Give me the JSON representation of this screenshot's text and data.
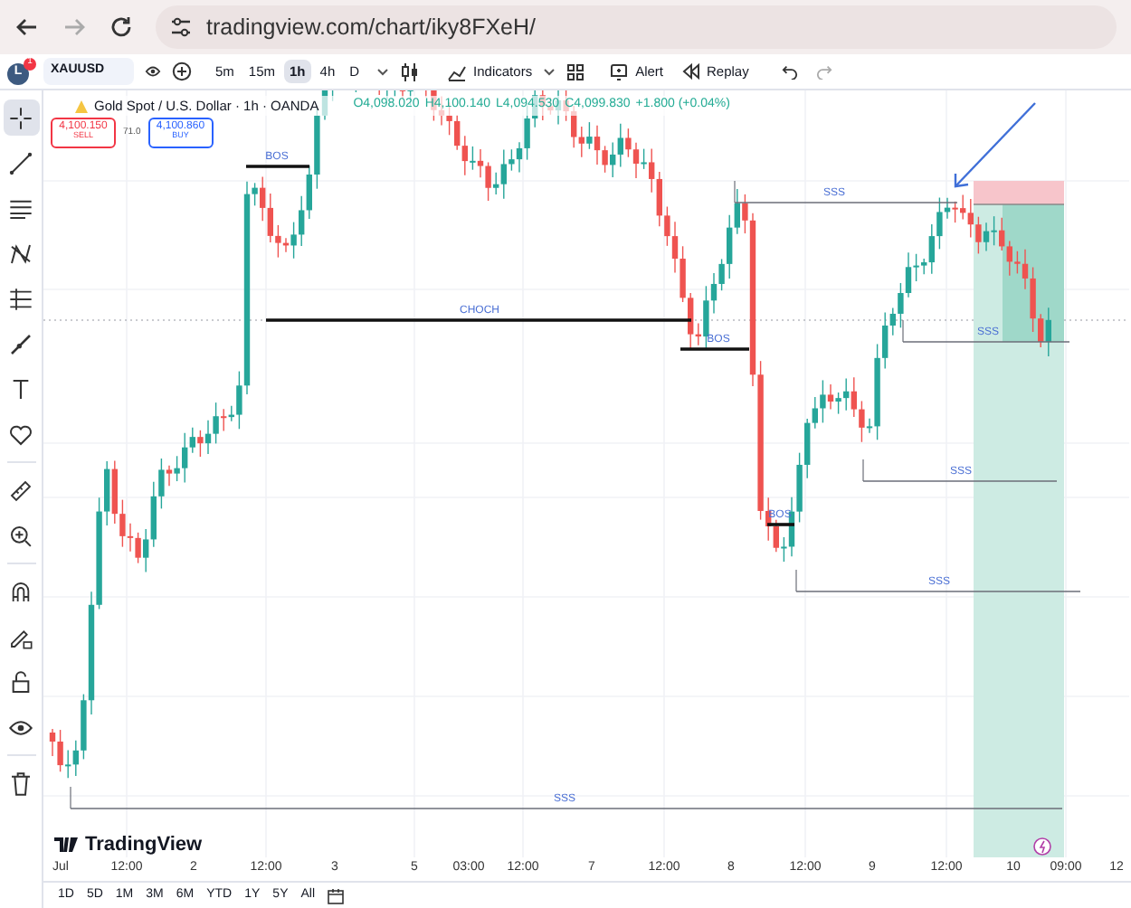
{
  "browser": {
    "url": "tradingview.com/chart/iky8FXeH/"
  },
  "toolbar": {
    "avatar": "L",
    "badge": "1",
    "symbol": "XAUUSD",
    "intervals": [
      {
        "label": "5m",
        "selected": false
      },
      {
        "label": "15m",
        "selected": false
      },
      {
        "label": "1h",
        "selected": true
      },
      {
        "label": "4h",
        "selected": false
      },
      {
        "label": "D",
        "selected": false
      }
    ],
    "indicators": "Indicators",
    "alert": "Alert",
    "replay": "Replay"
  },
  "left_tools": [
    {
      "kind": "crosshair",
      "selected": true
    },
    {
      "kind": "trend",
      "selected": false
    },
    {
      "kind": "lines",
      "selected": false
    },
    {
      "kind": "pattern",
      "selected": false
    },
    {
      "kind": "forecast",
      "selected": false
    },
    {
      "kind": "brush",
      "selected": false
    },
    {
      "kind": "text",
      "selected": false
    },
    {
      "kind": "heart",
      "selected": false
    },
    {
      "kind": "ruler",
      "selected": false
    },
    {
      "kind": "zoom",
      "selected": false
    },
    {
      "kind": "magnet",
      "selected": false
    },
    {
      "kind": "pencil",
      "selected": false
    },
    {
      "kind": "lock",
      "selected": false
    },
    {
      "kind": "eye",
      "selected": false
    },
    {
      "kind": "trash",
      "selected": false
    }
  ],
  "legend": {
    "title": "Gold Spot / U.S. Dollar · 1h · OANDA",
    "open": "O4,098.020",
    "high": "H4,100.140",
    "low": "L4,094.530",
    "close": "C4,099.830",
    "change": "+1.800 (+0.04%)"
  },
  "trade": {
    "sell_price": "4,100.150",
    "sell": "SELL",
    "spread": "71.0",
    "buy_price": "4,100.860",
    "buy": "BUY"
  },
  "annotations": [
    {
      "kind": "break",
      "label": "BOS"
    },
    {
      "kind": "break",
      "label": "CHOCH"
    },
    {
      "kind": "break",
      "label": "BOS"
    },
    {
      "kind": "liquidity",
      "label": "SSS"
    },
    {
      "kind": "liquidity",
      "label": "SSS"
    },
    {
      "kind": "liquidity",
      "label": "SSS"
    },
    {
      "kind": "break",
      "label": "BOS"
    },
    {
      "kind": "liquidity",
      "label": "SSS"
    },
    {
      "kind": "liquidity",
      "label": "SSS"
    }
  ],
  "logo": "TradingView",
  "time_axis": [
    "Jul",
    "12:00",
    "2",
    "12:00",
    "3",
    "5",
    "03:00",
    "12:00",
    "7",
    "12:00",
    "8",
    "12:00",
    "9",
    "12:00",
    "10",
    "09:00",
    "12"
  ],
  "ranges": [
    "1D",
    "5D",
    "1M",
    "3M",
    "6M",
    "YTD",
    "1Y",
    "5Y",
    "All"
  ]
}
